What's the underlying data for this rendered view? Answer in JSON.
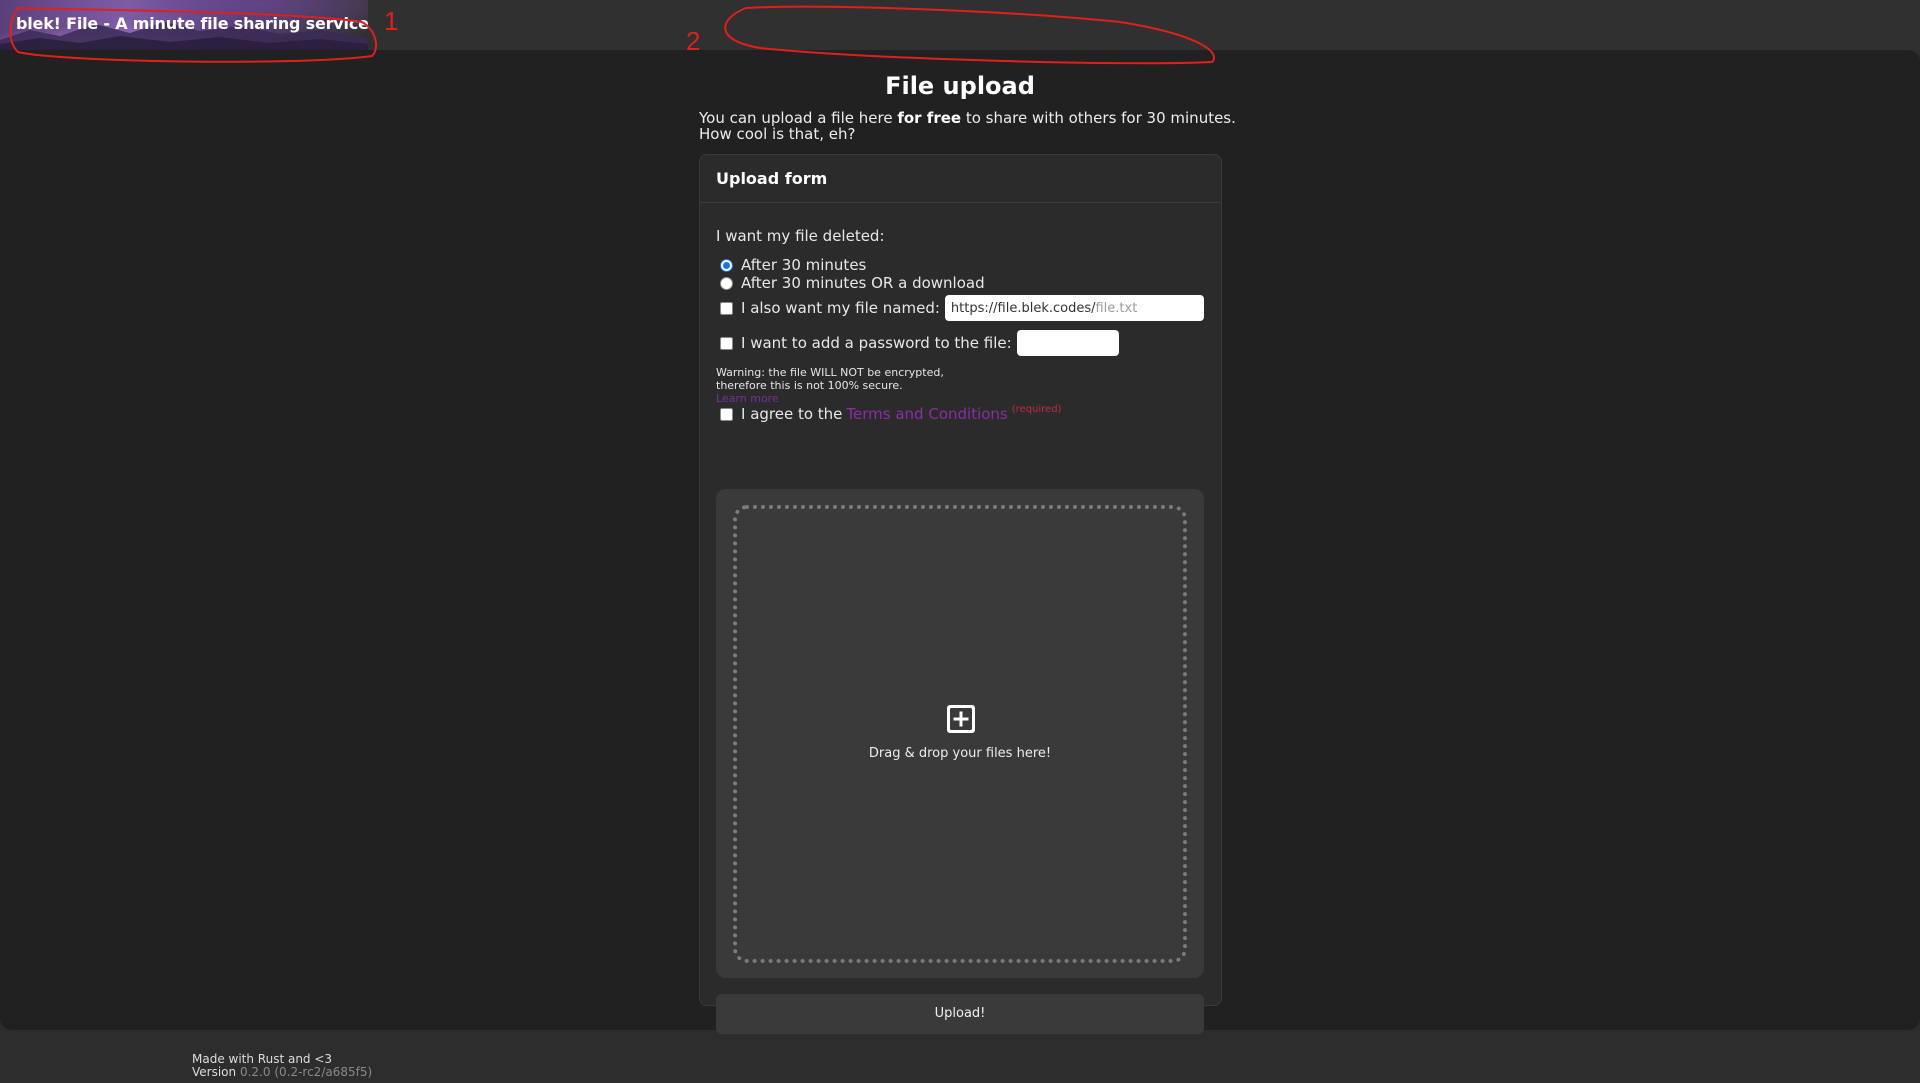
{
  "header": {
    "title": "blek! File - A minute file sharing service"
  },
  "annotations": {
    "one": "1",
    "two": "2",
    "color": "#e0201c"
  },
  "page": {
    "title": "File upload",
    "intro_part1": "You can upload a file here ",
    "intro_bold": "for free",
    "intro_part2": " to share with others for 30 minutes.",
    "intro_line2": "How cool is that, eh?"
  },
  "form": {
    "card_title": "Upload form",
    "deletion_label": "I want my file deleted:",
    "deletion_options": [
      {
        "label": "After 30 minutes",
        "checked": true
      },
      {
        "label": "After 30 minutes OR a download",
        "checked": false
      }
    ],
    "name_checkbox_label": "I also want my file named:",
    "name_prefix": "https://file.blek.codes/",
    "name_placeholder": "file.txt",
    "password_checkbox_label": "I want to add a password to the file:",
    "warning_line1": "Warning: the file WILL NOT be encrypted,",
    "warning_line2": "therefore this is not 100% secure.",
    "learn_more": "Learn more",
    "terms_prefix": "I agree to the",
    "terms_link": "Terms and Conditions",
    "terms_required": "(required)",
    "dropzone_text": "Drag & drop your files here!",
    "dropzone_icon": "plus-square-icon",
    "upload_label": "Upload!"
  },
  "footer": {
    "made_with": "Made with Rust and <3",
    "version_label": "Version",
    "version_value": "0.2.0 (0.2-rc2/a685f5)"
  },
  "colors": {
    "background_main": "#212121",
    "background_header": "#303030",
    "card": "#2b2b2b",
    "link_purple": "#8a2ea8",
    "required_red": "#c22a46",
    "radio_blue": "#1a73e8"
  }
}
